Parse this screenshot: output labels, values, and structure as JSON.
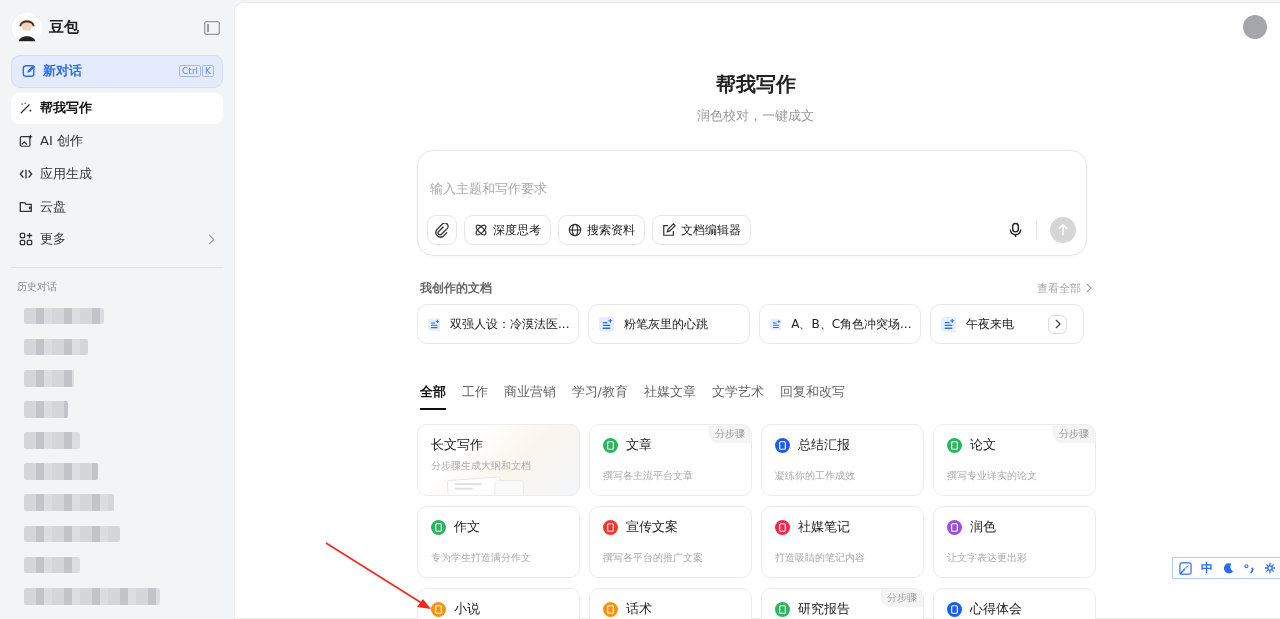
{
  "sidebar": {
    "app_name": "豆包",
    "new_chat": {
      "label": "新对话",
      "shortcut": [
        "Ctrl",
        "K"
      ]
    },
    "nav": [
      {
        "label": "帮我写作",
        "kind": "write",
        "selected": true
      },
      {
        "label": "AI 创作",
        "kind": "image",
        "selected": false
      },
      {
        "label": "应用生成",
        "kind": "code",
        "selected": false
      },
      {
        "label": "云盘",
        "kind": "folder",
        "selected": false
      },
      {
        "label": "更多",
        "kind": "apps",
        "selected": false
      }
    ],
    "history_title": "历史对话",
    "history": [
      {
        "kind": "redacted"
      },
      {
        "kind": "redacted"
      },
      {
        "kind": "redacted"
      },
      {
        "kind": "redacted"
      },
      {
        "kind": "redacted"
      },
      {
        "kind": "redacted"
      },
      {
        "kind": "redacted"
      },
      {
        "kind": "redacted"
      },
      {
        "kind": "redacted"
      },
      {
        "kind": "redacted"
      }
    ]
  },
  "main": {
    "title": "帮我写作",
    "subtitle": "润色校对，一键成文",
    "composer": {
      "placeholder": "输入主题和写作要求",
      "tools": [
        {
          "label": "深度思考",
          "kind": "think"
        },
        {
          "label": "搜索资料",
          "kind": "globe"
        },
        {
          "label": "文档编辑器",
          "kind": "edit"
        }
      ]
    },
    "docs": {
      "title": "我创作的文档",
      "view_all": "查看全部",
      "items": [
        "双强人设：冷漠法医...",
        "粉笔灰里的心跳",
        "A、B、C角色冲突场...",
        "午夜来电"
      ]
    },
    "tabs": [
      {
        "label": "全部",
        "selected": true
      },
      {
        "label": "工作",
        "selected": false
      },
      {
        "label": "商业营销",
        "selected": false
      },
      {
        "label": "学习/教育",
        "selected": false
      },
      {
        "label": "社媒文章",
        "selected": false
      },
      {
        "label": "文学艺术",
        "selected": false
      },
      {
        "label": "回复和改写",
        "selected": false
      }
    ],
    "cards": [
      {
        "kind": "featured",
        "title": "长文写作",
        "desc": "分步骤生成大纲和文档"
      },
      {
        "kind": "tool",
        "title": "文章",
        "desc": "撰写各主流平台文章",
        "badge": "分步骤",
        "color": "#2db55d"
      },
      {
        "kind": "tool",
        "title": "总结汇报",
        "desc": "凝练你的工作成效",
        "color": "#1a5cf0"
      },
      {
        "kind": "tool",
        "title": "论文",
        "desc": "撰写专业详实的论文",
        "badge": "分步骤",
        "color": "#2db55d"
      },
      {
        "kind": "tool",
        "title": "作文",
        "desc": "专为学生打造满分作文",
        "color": "#2db55d"
      },
      {
        "kind": "tool",
        "title": "宣传文案",
        "desc": "撰写各平台的推广文案",
        "color": "#f0392b"
      },
      {
        "kind": "tool",
        "title": "社媒笔记",
        "desc": "打造吸睛的笔记内容",
        "color": "#f0294a"
      },
      {
        "kind": "tool",
        "title": "润色",
        "desc": "让文字表达更出彩",
        "color": "#9b4fe0"
      },
      {
        "kind": "tool",
        "title": "小说",
        "color": "#f7930f"
      },
      {
        "kind": "tool",
        "title": "话术",
        "color": "#f7930f"
      },
      {
        "kind": "tool",
        "title": "研究报告",
        "badge": "分步骤",
        "color": "#2db55d"
      },
      {
        "kind": "tool",
        "title": "心得体会",
        "color": "#1a5cf0"
      }
    ]
  },
  "ime_toolbar": {
    "mode": "中"
  }
}
